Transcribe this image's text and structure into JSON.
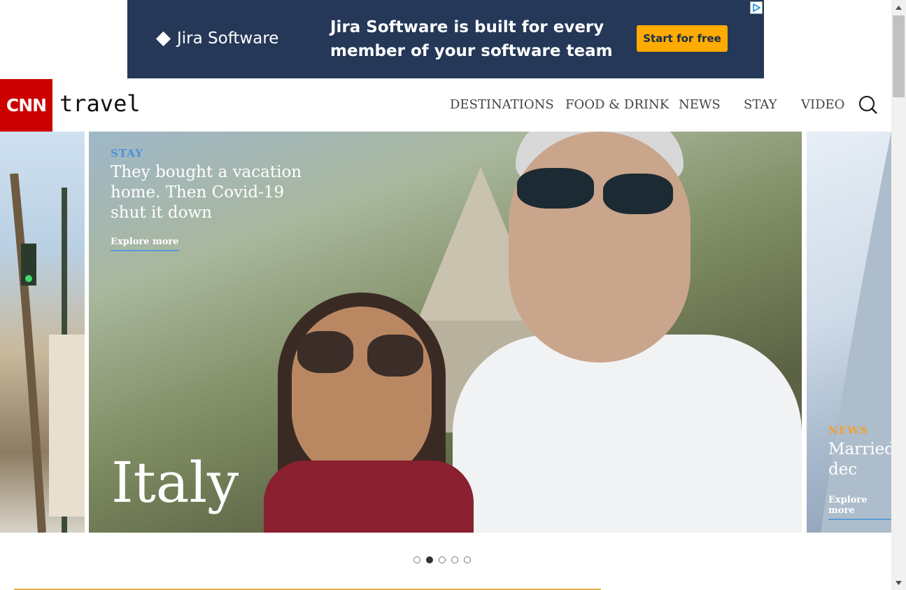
{
  "ad": {
    "brand": "Jira Software",
    "headline": "Jira Software is built for every member of your software team",
    "cta": "Start for free",
    "colors": {
      "background": "#253858",
      "cta": "#FFAB00"
    }
  },
  "header": {
    "logo_text": "CNN",
    "section": "travel",
    "nav": [
      "DESTINATIONS",
      "FOOD & DRINK",
      "NEWS",
      "STAY",
      "VIDEO"
    ],
    "search_icon": "search-icon",
    "colors": {
      "logo_bg": "#cc0000"
    }
  },
  "carousel": {
    "main": {
      "label": "STAY",
      "title": "They bought a vacation home. Then Covid-19 shut it down",
      "cta": "Explore more",
      "place": "Italy",
      "label_color": "#4a90d9"
    },
    "next": {
      "label": "NEWS",
      "title": "Married after dec",
      "cta": "Explore more",
      "label_color": "#f0a030"
    },
    "dots_total": 5,
    "active_dot": 2
  },
  "scrollbar": {
    "up_icon": "scroll-up-icon",
    "down_icon": "scroll-down-icon"
  }
}
